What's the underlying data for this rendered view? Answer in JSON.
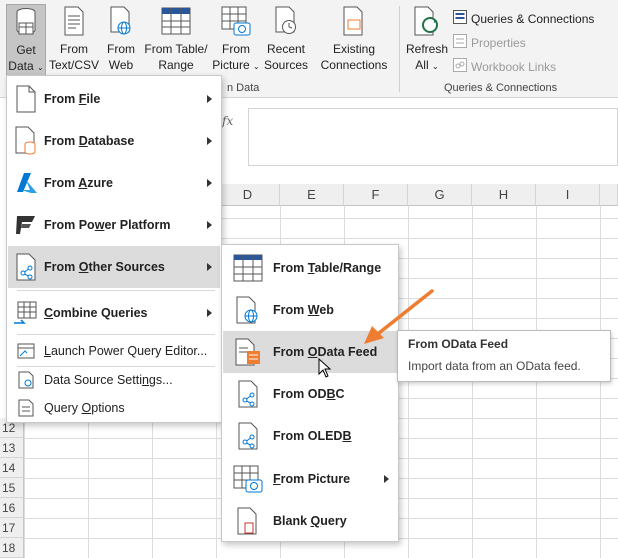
{
  "ribbon": {
    "buttons": [
      {
        "line1": "Get",
        "line2": "Data",
        "has_caret": true
      },
      {
        "line1": "From",
        "line2": "Text/CSV"
      },
      {
        "line1": "From",
        "line2": "Web"
      },
      {
        "line1": "From Table/",
        "line2": "Range"
      },
      {
        "line1": "From",
        "line2": "Picture",
        "has_caret": true
      },
      {
        "line1": "Recent",
        "line2": "Sources"
      },
      {
        "line1": "Existing",
        "line2": "Connections"
      },
      {
        "line1": "Refresh",
        "line2": "All",
        "has_caret": true
      }
    ],
    "get_transform_group_label": "n Data",
    "queries_group_label": "Queries & Connections",
    "qc_items": [
      {
        "label": "Queries & Connections",
        "enabled": true
      },
      {
        "label": "Properties",
        "enabled": false
      },
      {
        "label": "Workbook Links",
        "enabled": false
      }
    ]
  },
  "formula_bar": {
    "fx": "fx"
  },
  "grid": {
    "columns": [
      "D",
      "E",
      "F",
      "G",
      "H",
      "I"
    ],
    "rows": [
      "12",
      "13",
      "14",
      "15",
      "16",
      "17",
      "18"
    ]
  },
  "main_menu": {
    "items": [
      {
        "prefix": "From ",
        "key": "F",
        "rest": "ile",
        "has_submenu": true
      },
      {
        "prefix": "From ",
        "key": "D",
        "rest": "atabase",
        "has_submenu": true
      },
      {
        "prefix": "From ",
        "key": "A",
        "rest": "zure",
        "has_submenu": true
      },
      {
        "prefix": "From Po",
        "key": "w",
        "rest": "er Platform",
        "has_submenu": true
      },
      {
        "prefix": "From ",
        "key": "O",
        "rest": "ther Sources",
        "has_submenu": true
      },
      {
        "prefix": "",
        "key": "C",
        "rest": "ombine Queries",
        "has_submenu": true
      },
      {
        "prefix": "",
        "key": "L",
        "rest": "aunch Power Query Editor..."
      },
      {
        "prefix": "Data Source Setti",
        "key": "n",
        "rest": "gs..."
      },
      {
        "prefix": "Query ",
        "key": "O",
        "rest": "ptions"
      }
    ]
  },
  "sub_menu": {
    "items": [
      {
        "prefix": "From ",
        "key": "T",
        "rest": "able/Range"
      },
      {
        "prefix": "From ",
        "key": "W",
        "rest": "eb"
      },
      {
        "prefix": "From ",
        "key": "O",
        "rest": "Data Feed"
      },
      {
        "prefix": "From OD",
        "key": "B",
        "rest": "C"
      },
      {
        "prefix": "From OLED",
        "key": "B",
        "rest": ""
      },
      {
        "prefix": "",
        "key": "F",
        "rest": "rom Picture",
        "has_submenu": true
      },
      {
        "prefix": "Blank ",
        "key": "Q",
        "rest": "uery"
      }
    ]
  },
  "tooltip": {
    "title": "From OData Feed",
    "description": "Import data from an OData feed."
  },
  "colors": {
    "accent_arrow": "#ed7d31",
    "azure": "#0078d4",
    "excel_green": "#217346"
  }
}
